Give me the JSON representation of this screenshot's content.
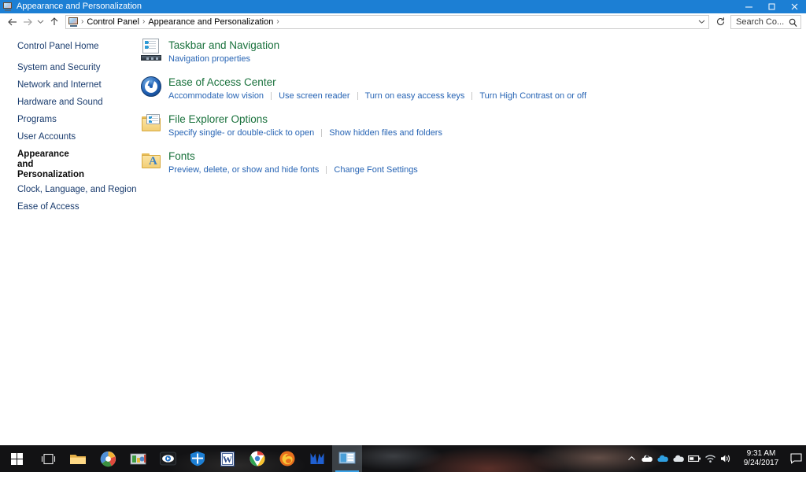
{
  "window": {
    "title": "Appearance and Personalization",
    "icon": "control-panel-icon",
    "minimize": "–",
    "maximize": "▢",
    "close": "✕"
  },
  "nav": {
    "back": "back-arrow",
    "forward": "forward-arrow",
    "recent": "recent-locations-chevron",
    "up": "up-arrow",
    "refresh": "refresh-icon",
    "breadcrumb": {
      "icon": "control-panel-icon",
      "items": [
        "Control Panel",
        "Appearance and Personalization"
      ],
      "separator": "›",
      "trailing_separator": "›"
    },
    "dropdown": "chevron-down-icon"
  },
  "search": {
    "value": "Search Co...",
    "placeholder": "Search Control Panel",
    "icon": "search-icon"
  },
  "sidebar": {
    "items": [
      {
        "label": "Control Panel Home",
        "current": false
      },
      {
        "label": "System and Security",
        "current": false
      },
      {
        "label": "Network and Internet",
        "current": false
      },
      {
        "label": "Hardware and Sound",
        "current": false
      },
      {
        "label": "Programs",
        "current": false
      },
      {
        "label": "User Accounts",
        "current": false
      },
      {
        "label": "Appearance and Personalization",
        "current": true
      },
      {
        "label": "Clock, Language, and Region",
        "current": false
      },
      {
        "label": "Ease of Access",
        "current": false
      }
    ]
  },
  "main": {
    "categories": [
      {
        "icon": "taskbar-navigation-icon",
        "title": "Taskbar and Navigation",
        "links": [
          "Navigation properties"
        ]
      },
      {
        "icon": "ease-of-access-icon",
        "title": "Ease of Access Center",
        "links": [
          "Accommodate low vision",
          "Use screen reader",
          "Turn on easy access keys",
          "Turn High Contrast on or off"
        ]
      },
      {
        "icon": "file-explorer-options-icon",
        "title": "File Explorer Options",
        "links": [
          "Specify single- or double-click to open",
          "Show hidden files and folders"
        ]
      },
      {
        "icon": "fonts-icon",
        "title": "Fonts",
        "links": [
          "Preview, delete, or show and hide fonts",
          "Change Font Settings"
        ]
      }
    ]
  },
  "taskbar": {
    "items": [
      {
        "name": "start-button",
        "icon": "windows-logo-icon",
        "active": false
      },
      {
        "name": "task-view-button",
        "icon": "task-view-icon",
        "active": false
      },
      {
        "name": "file-explorer-button",
        "icon": "folder-icon",
        "active": false
      },
      {
        "name": "picasa-button",
        "icon": "picasa-icon",
        "active": false
      },
      {
        "name": "media-app-button",
        "icon": "media-app-icon",
        "active": false
      },
      {
        "name": "eye-app-button",
        "icon": "eye-icon",
        "active": false
      },
      {
        "name": "defender-button",
        "icon": "shield-icon",
        "active": false
      },
      {
        "name": "word-button",
        "icon": "word-icon",
        "active": false
      },
      {
        "name": "chrome-button",
        "icon": "chrome-icon",
        "active": false
      },
      {
        "name": "firefox-button",
        "icon": "firefox-icon",
        "active": false
      },
      {
        "name": "malwarebytes-button",
        "icon": "m-logo-icon",
        "active": false
      },
      {
        "name": "control-panel-button",
        "icon": "control-panel-icon",
        "active": true
      }
    ],
    "tray": {
      "icons": [
        "show-hidden-icons-chevron",
        "onedrive-sync-icon",
        "cloud-blue-icon",
        "cloud-white-icon",
        "battery-icon",
        "wifi-icon",
        "volume-icon"
      ],
      "time": "9:31 AM",
      "date": "9/24/2017",
      "action_center": "action-center-icon"
    }
  },
  "colors": {
    "titlebar": "#1c7fd4",
    "heading_green": "#19713c",
    "link_blue": "#2764b4",
    "sidebar_link": "#1a3c6e",
    "taskbar": "#121214",
    "active_underline": "#3ea4e8"
  }
}
